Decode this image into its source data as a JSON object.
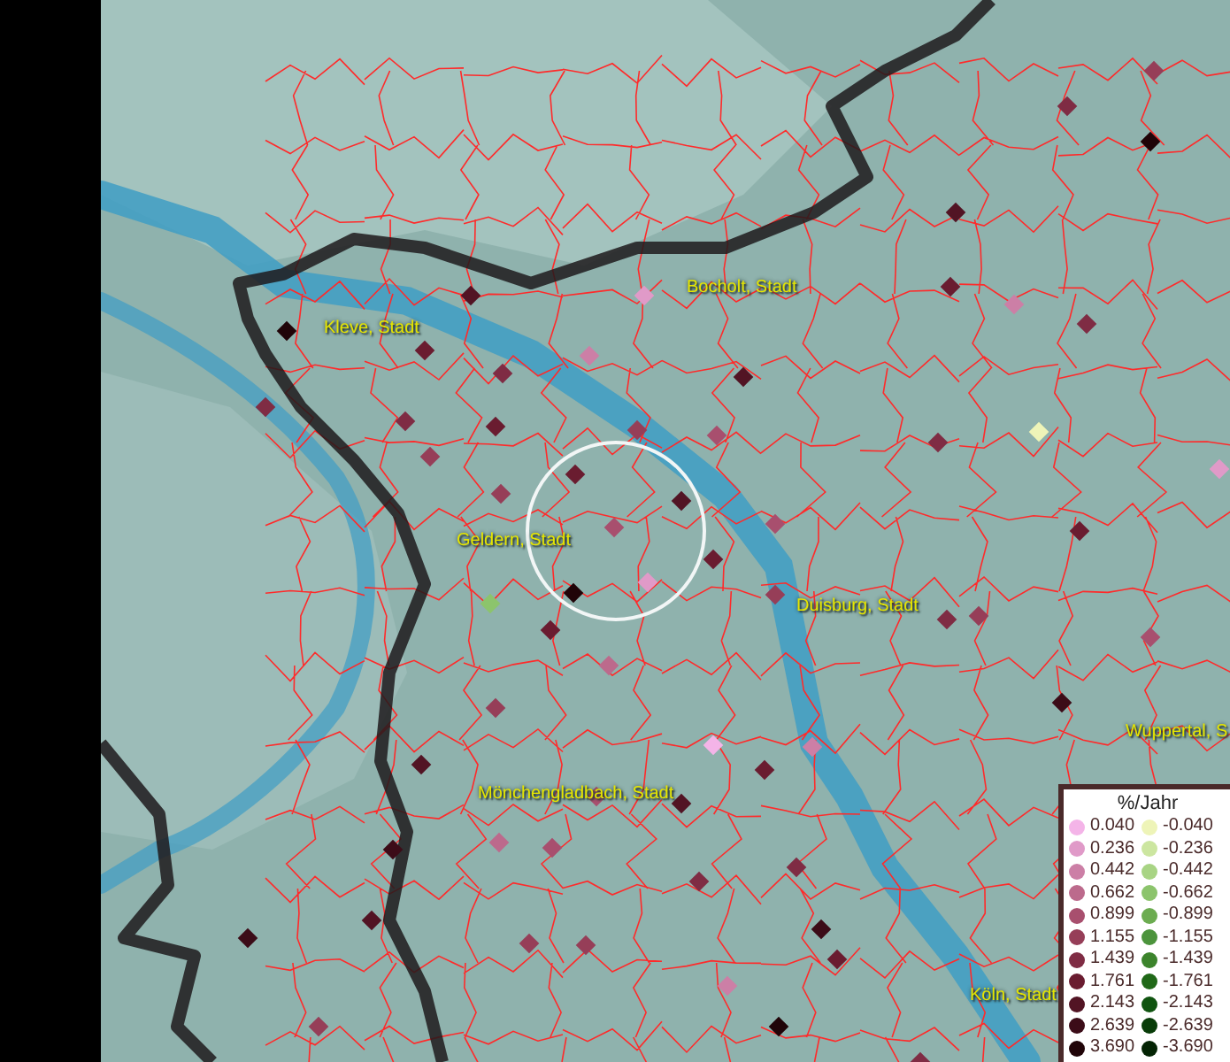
{
  "map": {
    "labels": [
      {
        "text": "Bocholt, Stadt"
      },
      {
        "text": "Kleve, Stadt"
      },
      {
        "text": "Geldern, Stadt"
      },
      {
        "text": "Duisburg, Stadt"
      },
      {
        "text": "Wuppertal, S"
      },
      {
        "text": "Mönchengladbach, Stadt"
      },
      {
        "text": "Köln, Stadt"
      }
    ]
  },
  "legend": {
    "title": "%/Jahr",
    "positive": [
      {
        "label": "0.040",
        "color": "#f4b4e8"
      },
      {
        "label": "0.236",
        "color": "#e09ac8"
      },
      {
        "label": "0.442",
        "color": "#cc7fa6"
      },
      {
        "label": "0.662",
        "color": "#bc6a8c"
      },
      {
        "label": "0.899",
        "color": "#a84f6e"
      },
      {
        "label": "1.155",
        "color": "#963e58"
      },
      {
        "label": "1.439",
        "color": "#7f2c44"
      },
      {
        "label": "1.761",
        "color": "#6a1c30"
      },
      {
        "label": "2.143",
        "color": "#521424"
      },
      {
        "label": "2.639",
        "color": "#3c0c18"
      },
      {
        "label": "3.690",
        "color": "#200408"
      }
    ],
    "negative": [
      {
        "label": "-0.040",
        "color": "#eef4b8"
      },
      {
        "label": "-0.236",
        "color": "#cce6a0"
      },
      {
        "label": "-0.442",
        "color": "#a8d484"
      },
      {
        "label": "-0.662",
        "color": "#8cc46c"
      },
      {
        "label": "-0.899",
        "color": "#6cac50"
      },
      {
        "label": "-1.155",
        "color": "#4c943c"
      },
      {
        "label": "-1.439",
        "color": "#3c842c"
      },
      {
        "label": "-1.761",
        "color": "#206818"
      },
      {
        "label": "-2.143",
        "color": "#105410"
      },
      {
        "label": "-2.639",
        "color": "#083c08"
      },
      {
        "label": "-3.690",
        "color": "#042404"
      }
    ]
  }
}
